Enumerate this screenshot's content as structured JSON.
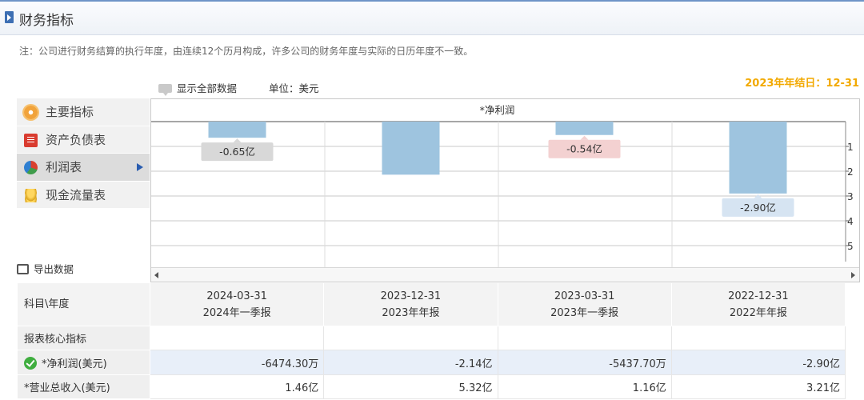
{
  "header": {
    "title": "财务指标"
  },
  "note": "注：公司进行财务结算的执行年度，由连续12个历月构成，许多公司的财务年度与实际的日历年度不一致。",
  "toolbar": {
    "show_all": "显示全部数据",
    "unit": "单位：美元"
  },
  "fiscal_year_end": "2023年年结日：12-31",
  "menu": [
    {
      "label": "主要指标",
      "icon": "gear-icon"
    },
    {
      "label": "资产负债表",
      "icon": "document-icon"
    },
    {
      "label": "利润表",
      "icon": "pie-chart-icon",
      "active": true
    },
    {
      "label": "现金流量表",
      "icon": "coins-icon"
    }
  ],
  "export_label": "导出数据",
  "chart_data": {
    "type": "bar",
    "title": "*净利润",
    "categories": [
      "2024-03-31",
      "2023-12-31",
      "2023-03-31",
      "2022-12-31"
    ],
    "values": [
      -0.65,
      -2.14,
      -0.54,
      -2.9
    ],
    "data_labels": [
      "-0.65亿",
      "",
      "-0.54亿",
      "-2.90亿"
    ],
    "label_colors": [
      "#d8d8d8",
      "",
      "#f3d1d1",
      "#d6e4f2"
    ],
    "bar_color": "#9ec4df",
    "ylim": [
      -5,
      0
    ],
    "yticks": [
      1,
      2,
      3,
      4,
      5
    ],
    "ytick_values": [
      -1,
      -2,
      -3,
      -4,
      -5
    ],
    "grid": true
  },
  "table": {
    "corner": "科目\\年度",
    "columns": [
      {
        "date": "2024-03-31",
        "period": "2024年一季报"
      },
      {
        "date": "2023-12-31",
        "period": "2023年年报"
      },
      {
        "date": "2023-03-31",
        "period": "2023年一季报"
      },
      {
        "date": "2022-12-31",
        "period": "2022年年报"
      }
    ],
    "section": "报表核心指标",
    "rows": [
      {
        "label": "*净利润(美元)",
        "values": [
          "-6474.30万",
          "-2.14亿",
          "-5437.70万",
          "-2.90亿"
        ]
      },
      {
        "label": "*营业总收入(美元)",
        "values": [
          "1.46亿",
          "5.32亿",
          "1.16亿",
          "3.21亿"
        ]
      }
    ]
  }
}
